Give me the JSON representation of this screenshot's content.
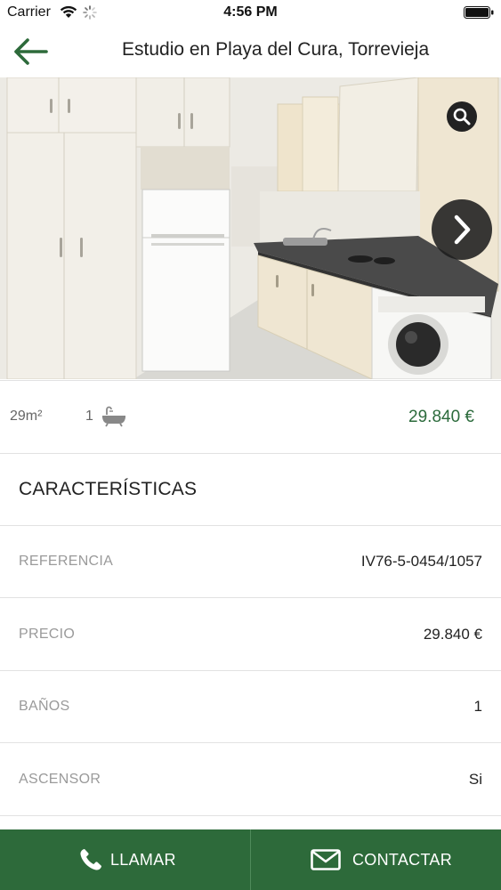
{
  "status_bar": {
    "carrier": "Carrier",
    "time": "4:56 PM",
    "icons": [
      "wifi-icon",
      "activity-spinner-icon",
      "battery-icon"
    ]
  },
  "nav": {
    "title": "Estudio en Playa del Cura, Torrevieja",
    "back_icon": "arrow-left-icon"
  },
  "gallery": {
    "image_subject": "kitchen",
    "zoom_icon": "magnifier-icon",
    "next_icon": "chevron-right-icon"
  },
  "summary": {
    "area": "29m²",
    "baths": "1",
    "baths_icon": "bathtub-icon",
    "price": "29.840 €"
  },
  "section": {
    "title": "CARACTERÍSTICAS"
  },
  "features": [
    {
      "label": "REFERENCIA",
      "value": "IV76-5-0454/1057"
    },
    {
      "label": "PRECIO",
      "value": "29.840 €"
    },
    {
      "label": "BAÑOS",
      "value": "1"
    },
    {
      "label": "ASCENSOR",
      "value": "Si"
    }
  ],
  "actions": {
    "call_label": "LLAMAR",
    "contact_label": "CONTACTAR"
  },
  "colors": {
    "accent": "#2d6a3a",
    "price": "#2c6b3c",
    "divider": "#e2e2e2"
  }
}
